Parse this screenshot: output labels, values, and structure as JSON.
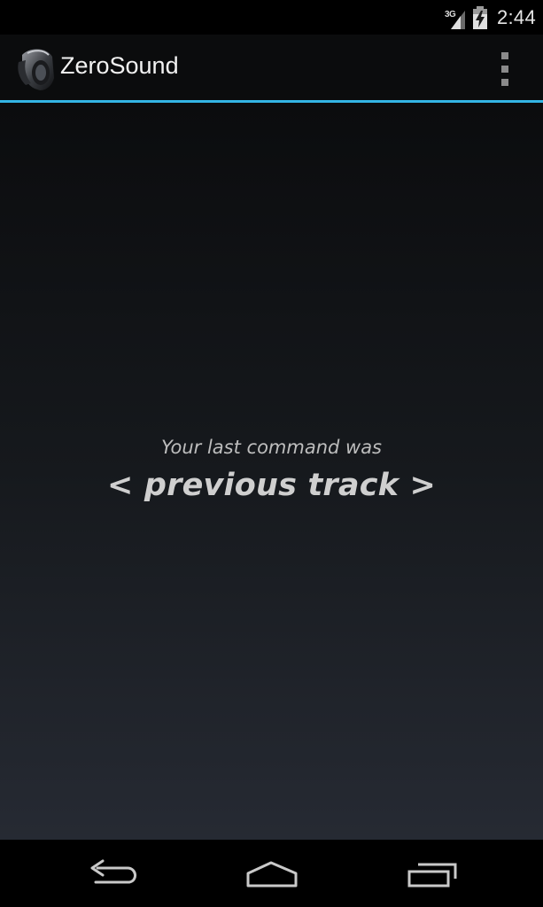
{
  "status_bar": {
    "network_type": "3G",
    "time": "2:44"
  },
  "action_bar": {
    "title": "ZeroSound",
    "icon": "headphones-app-icon",
    "accent_color": "#33b5e5"
  },
  "main": {
    "caption": "Your last command was",
    "command": "< previous track >"
  },
  "nav_bar": {
    "buttons": [
      "back-icon",
      "home-icon",
      "recent-apps-icon"
    ]
  }
}
